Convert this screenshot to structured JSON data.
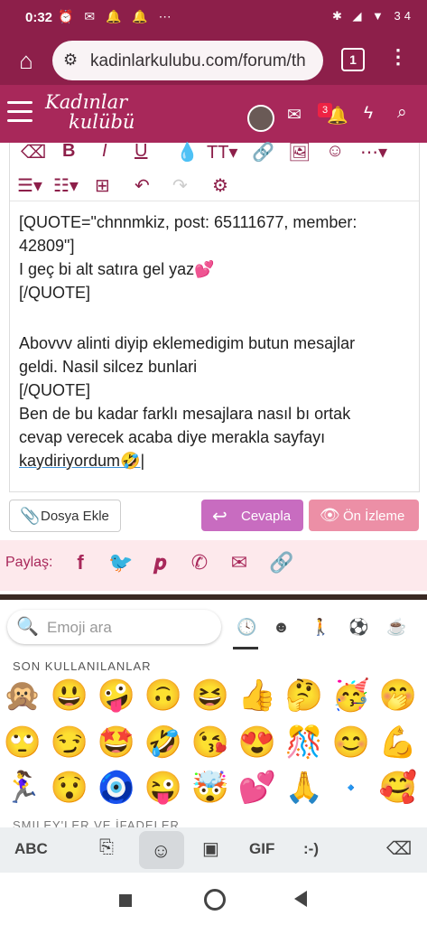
{
  "status_bar": {
    "time": "0:32",
    "left_icons": "⏰ ✉ 🔔 🔔 ⋯",
    "right_icons": "✱ ◢ ▼ 34"
  },
  "browser": {
    "url": "kadinlarkulubu.com/forum/th",
    "tab_count": "1"
  },
  "site_header": {
    "logo_line1": "Kadınlar",
    "logo_line2": "kulübü",
    "notification_count": "3"
  },
  "editor": {
    "lines": [
      "[QUOTE=\"chnnmkiz, post: 65111677, member:",
      "42809\"]",
      "I geç bi alt satıra gel yaz💕",
      "[/QUOTE]",
      "",
      "Abovvv alinti diyip eklemedigim butun mesajlar",
      "geldi. Nasil silcez bunlari",
      "[/QUOTE]",
      "Ben de bu kadar farklı mesajlara nasıl bı ortak",
      "cevap verecek acaba diye merakla sayfayı",
      "kaydiriyordum🤣|"
    ]
  },
  "buttons": {
    "attach": "Dosya Ekle",
    "reply": "Cevapla",
    "preview": "Ön İzleme"
  },
  "share": {
    "label": "Paylaş:"
  },
  "emoji_keyboard": {
    "search_placeholder": "Emoji ara",
    "recent_label": "SON KULLANILANLAR",
    "smileys_label": "SMILEY'LER VE İFADELER",
    "recent_emojis": [
      [
        "🙊",
        "😃",
        "🤪",
        "🙃",
        "😆",
        "👍",
        "🤔",
        "🥳",
        "🤭"
      ],
      [
        "🙄",
        "😏",
        "🤩",
        "🤣",
        "😘",
        "😍",
        "🎊",
        "😊",
        "💪"
      ],
      [
        "🏃‍♀️",
        "😯",
        "🧿",
        "😜",
        "🤯",
        "💕",
        "🙏",
        "🔹",
        "🥰"
      ]
    ],
    "bottom_keys": {
      "abc": "ABC",
      "gif": "GIF",
      "emoticon": ":-)"
    }
  }
}
